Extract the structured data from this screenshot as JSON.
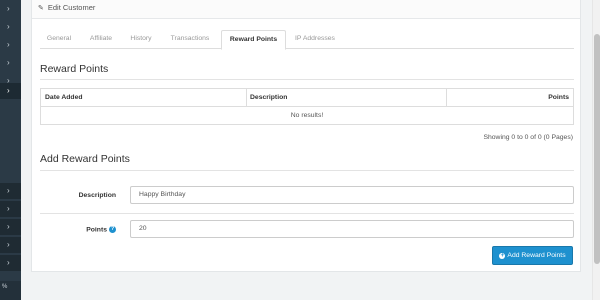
{
  "nav": {
    "chevron": "›",
    "bottom_label": "%"
  },
  "panel": {
    "heading": "Edit Customer"
  },
  "tabs": [
    {
      "label": "General"
    },
    {
      "label": "Affiliate"
    },
    {
      "label": "History"
    },
    {
      "label": "Transactions"
    },
    {
      "label": "Reward Points"
    },
    {
      "label": "IP Addresses"
    }
  ],
  "active_tab": "Reward Points",
  "reward_points": {
    "title": "Reward Points",
    "columns": [
      "Date Added",
      "Description",
      "Points"
    ],
    "empty_text": "No results!",
    "pagination_text": "Showing 0 to 0 of 0 (0 Pages)"
  },
  "add_form": {
    "title": "Add Reward Points",
    "description_label": "Description",
    "description_value": "Happy Birthday",
    "points_label": "Points",
    "points_value": "20",
    "submit_label": "Add Reward Points"
  },
  "colors": {
    "accent": "#1e91cf",
    "sidebar": "#2b3a46"
  }
}
